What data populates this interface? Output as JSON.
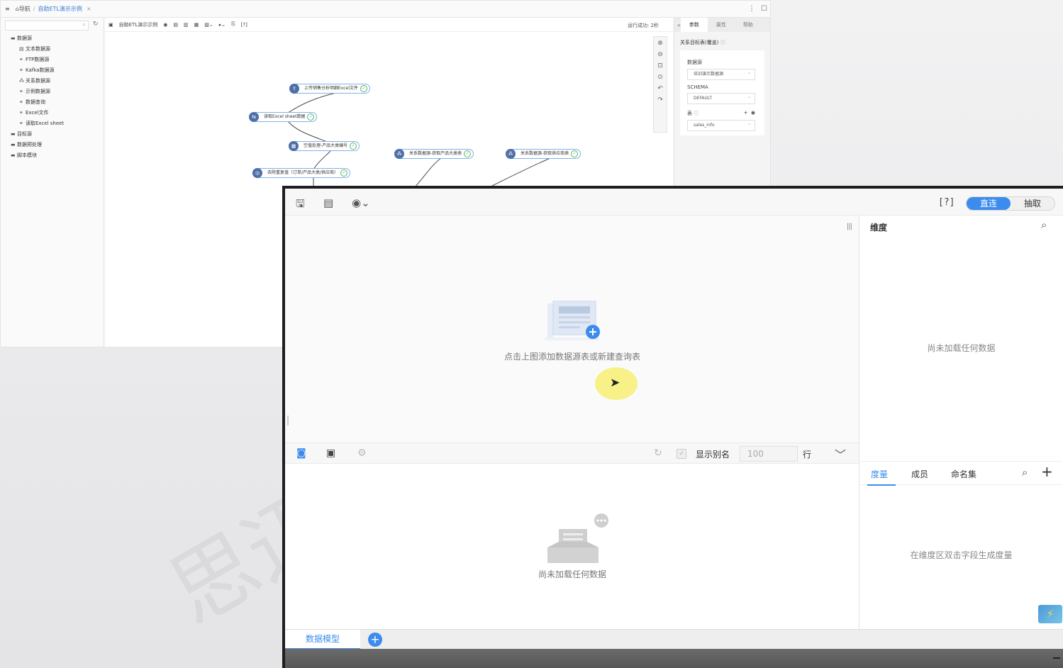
{
  "etl": {
    "breadcrumb": {
      "home": "导航",
      "tab": "自助ETL演示示例"
    },
    "tree": [
      {
        "label": "数据源",
        "icon": "folder-icon",
        "level": 0
      },
      {
        "label": "文本数据源",
        "icon": "file-icon",
        "level": 1
      },
      {
        "label": "FTP数据源",
        "icon": "link-icon",
        "level": 1
      },
      {
        "label": "Kafka数据源",
        "icon": "link-icon",
        "level": 1
      },
      {
        "label": "关系数据源",
        "icon": "network-icon",
        "level": 1
      },
      {
        "label": "示例数据源",
        "icon": "link-icon",
        "level": 1
      },
      {
        "label": "数据查询",
        "icon": "link-icon",
        "level": 1
      },
      {
        "label": "Excel文件",
        "icon": "link-icon",
        "level": 1
      },
      {
        "label": "读取Excel sheet",
        "icon": "link-icon",
        "level": 1
      },
      {
        "label": "目标源",
        "icon": "folder-icon",
        "level": 0
      },
      {
        "label": "数据预处理",
        "icon": "folder-icon",
        "level": 0
      },
      {
        "label": "脚本模块",
        "icon": "folder-icon",
        "level": 0
      }
    ],
    "toolbar": {
      "name": "自助ETL演示示例",
      "help": "[?]",
      "status": "运行成功: 2秒"
    },
    "nodes": [
      {
        "label": "上传销售分析明细Excel文件"
      },
      {
        "label": "读取Excel sheet数据"
      },
      {
        "label": "空值处理-产品大类编号"
      },
      {
        "label": "去除重复值（订单/产品大类/供应商）"
      },
      {
        "label": "关系数据源-获取产品大类表"
      },
      {
        "label": "关系数据源-获取供应商表"
      }
    ],
    "right_tabs": [
      "参数",
      "属性",
      "帮助"
    ],
    "panel": {
      "title": "关系目标表(覆盖)",
      "datasource_label": "数据源",
      "datasource_value": "培训演示数据源",
      "schema_label": "SCHEMA",
      "schema_value": "DEFAULT",
      "table_label": "表",
      "table_value": "sales_info"
    }
  },
  "watermark": "思迈",
  "toolbar": {
    "help": "[?]",
    "mode_direct": "直连",
    "mode_extract": "抽取"
  },
  "canvas": {
    "empty_text": "点击上图添加数据源表或新建查询表"
  },
  "grid_toolbar": {
    "alias_label": "显示别名",
    "rows_value": "100",
    "rows_unit": "行"
  },
  "grid": {
    "empty_text": "尚未加载任何数据"
  },
  "dimensions": {
    "title": "维度",
    "empty_text": "尚未加载任何数据"
  },
  "measures": {
    "tabs": [
      "度量",
      "成员",
      "命名集"
    ],
    "empty_text": "在维度区双击字段生成度量"
  },
  "bottom": {
    "model_tab": "数据模型"
  },
  "colors": {
    "accent": "#3b8ced",
    "cursor_halo": "#f7f07a"
  }
}
